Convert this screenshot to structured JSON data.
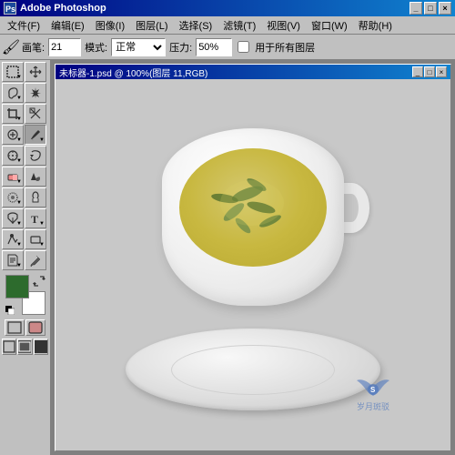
{
  "app": {
    "title": "Adobe Photoshop",
    "icon": "PS"
  },
  "title_bar": {
    "text": "Adobe Photoshop",
    "minimize": "_",
    "maximize": "□",
    "close": "×"
  },
  "menu_bar": {
    "items": [
      {
        "label": "文件(F)",
        "id": "file"
      },
      {
        "label": "编辑(E)",
        "id": "edit"
      },
      {
        "label": "图像(I)",
        "id": "image"
      },
      {
        "label": "图层(L)",
        "id": "layer"
      },
      {
        "label": "选择(S)",
        "id": "select"
      },
      {
        "label": "滤镜(T)",
        "id": "filter"
      },
      {
        "label": "视图(V)",
        "id": "view"
      },
      {
        "label": "窗口(W)",
        "id": "window"
      },
      {
        "label": "帮助(H)",
        "id": "help"
      }
    ]
  },
  "options_bar": {
    "tool_label": "画笔:",
    "brush_size": "21",
    "mode_label": "模式:",
    "mode_value": "正常",
    "pressure_label": "压力:",
    "pressure_value": "50%",
    "all_layers_label": "用于所有图层"
  },
  "document": {
    "title": "未标器-1.psd @ 100%(图层 11,RGB)",
    "min": "_",
    "max": "□",
    "close": "×"
  },
  "toolbar": {
    "tools": [
      {
        "id": "marquee",
        "icon": "⬚",
        "has_arrow": true
      },
      {
        "id": "move",
        "icon": "✛",
        "has_arrow": false
      },
      {
        "id": "lasso",
        "icon": "⌒",
        "has_arrow": true
      },
      {
        "id": "magic-wand",
        "icon": "✦",
        "has_arrow": false
      },
      {
        "id": "crop",
        "icon": "⊞",
        "has_arrow": false
      },
      {
        "id": "slice",
        "icon": "⧄",
        "has_arrow": true
      },
      {
        "id": "heal",
        "icon": "✚",
        "has_arrow": true
      },
      {
        "id": "brush",
        "icon": "✏",
        "has_arrow": true
      },
      {
        "id": "clone",
        "icon": "◎",
        "has_arrow": true
      },
      {
        "id": "eraser",
        "icon": "◻",
        "has_arrow": true
      },
      {
        "id": "gradient",
        "icon": "▦",
        "has_arrow": true
      },
      {
        "id": "blur",
        "icon": "◑",
        "has_arrow": true
      },
      {
        "id": "dodge",
        "icon": "○",
        "has_arrow": true
      },
      {
        "id": "path",
        "icon": "⬡",
        "has_arrow": true
      },
      {
        "id": "type",
        "icon": "T",
        "has_arrow": true
      },
      {
        "id": "shape",
        "icon": "⬟",
        "has_arrow": true
      },
      {
        "id": "notes",
        "icon": "✎",
        "has_arrow": true
      },
      {
        "id": "eyedropper",
        "icon": "✒",
        "has_arrow": true
      },
      {
        "id": "hand",
        "icon": "✋",
        "has_arrow": false
      },
      {
        "id": "zoom",
        "icon": "⊕",
        "has_arrow": false
      }
    ]
  },
  "watermark": {
    "symbol": "S",
    "text": "岁月斑驳"
  },
  "colors": {
    "foreground": "#2d6b2d",
    "background": "#ffffff",
    "accent_blue": "#000080",
    "toolbar_bg": "#c0c0c0",
    "workspace_bg": "#808080"
  }
}
